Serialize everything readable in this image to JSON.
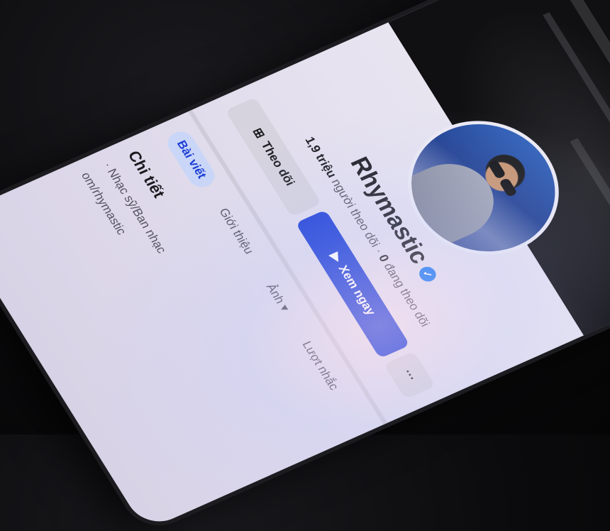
{
  "profile": {
    "name": "Rhymastic",
    "followers_count": "1,9 triệu",
    "followers_label": "người theo dõi",
    "following_count": "0",
    "following_label": "đang theo dõi"
  },
  "actions": {
    "follow_label": "Theo dõi",
    "watch_label": "Xem ngay",
    "more_label": "···"
  },
  "tabs": [
    {
      "label": "Bài viết"
    },
    {
      "label": "Giới thiệu"
    },
    {
      "label": "Ảnh"
    },
    {
      "label": "Lượt nhắc"
    }
  ],
  "details": {
    "title": "Chi tiết",
    "category": "· Nhạc sỹ/Ban nhạc",
    "link": "om/rhymastic"
  },
  "colors": {
    "accent": "#1d3fd6",
    "verified": "#1877f2"
  }
}
